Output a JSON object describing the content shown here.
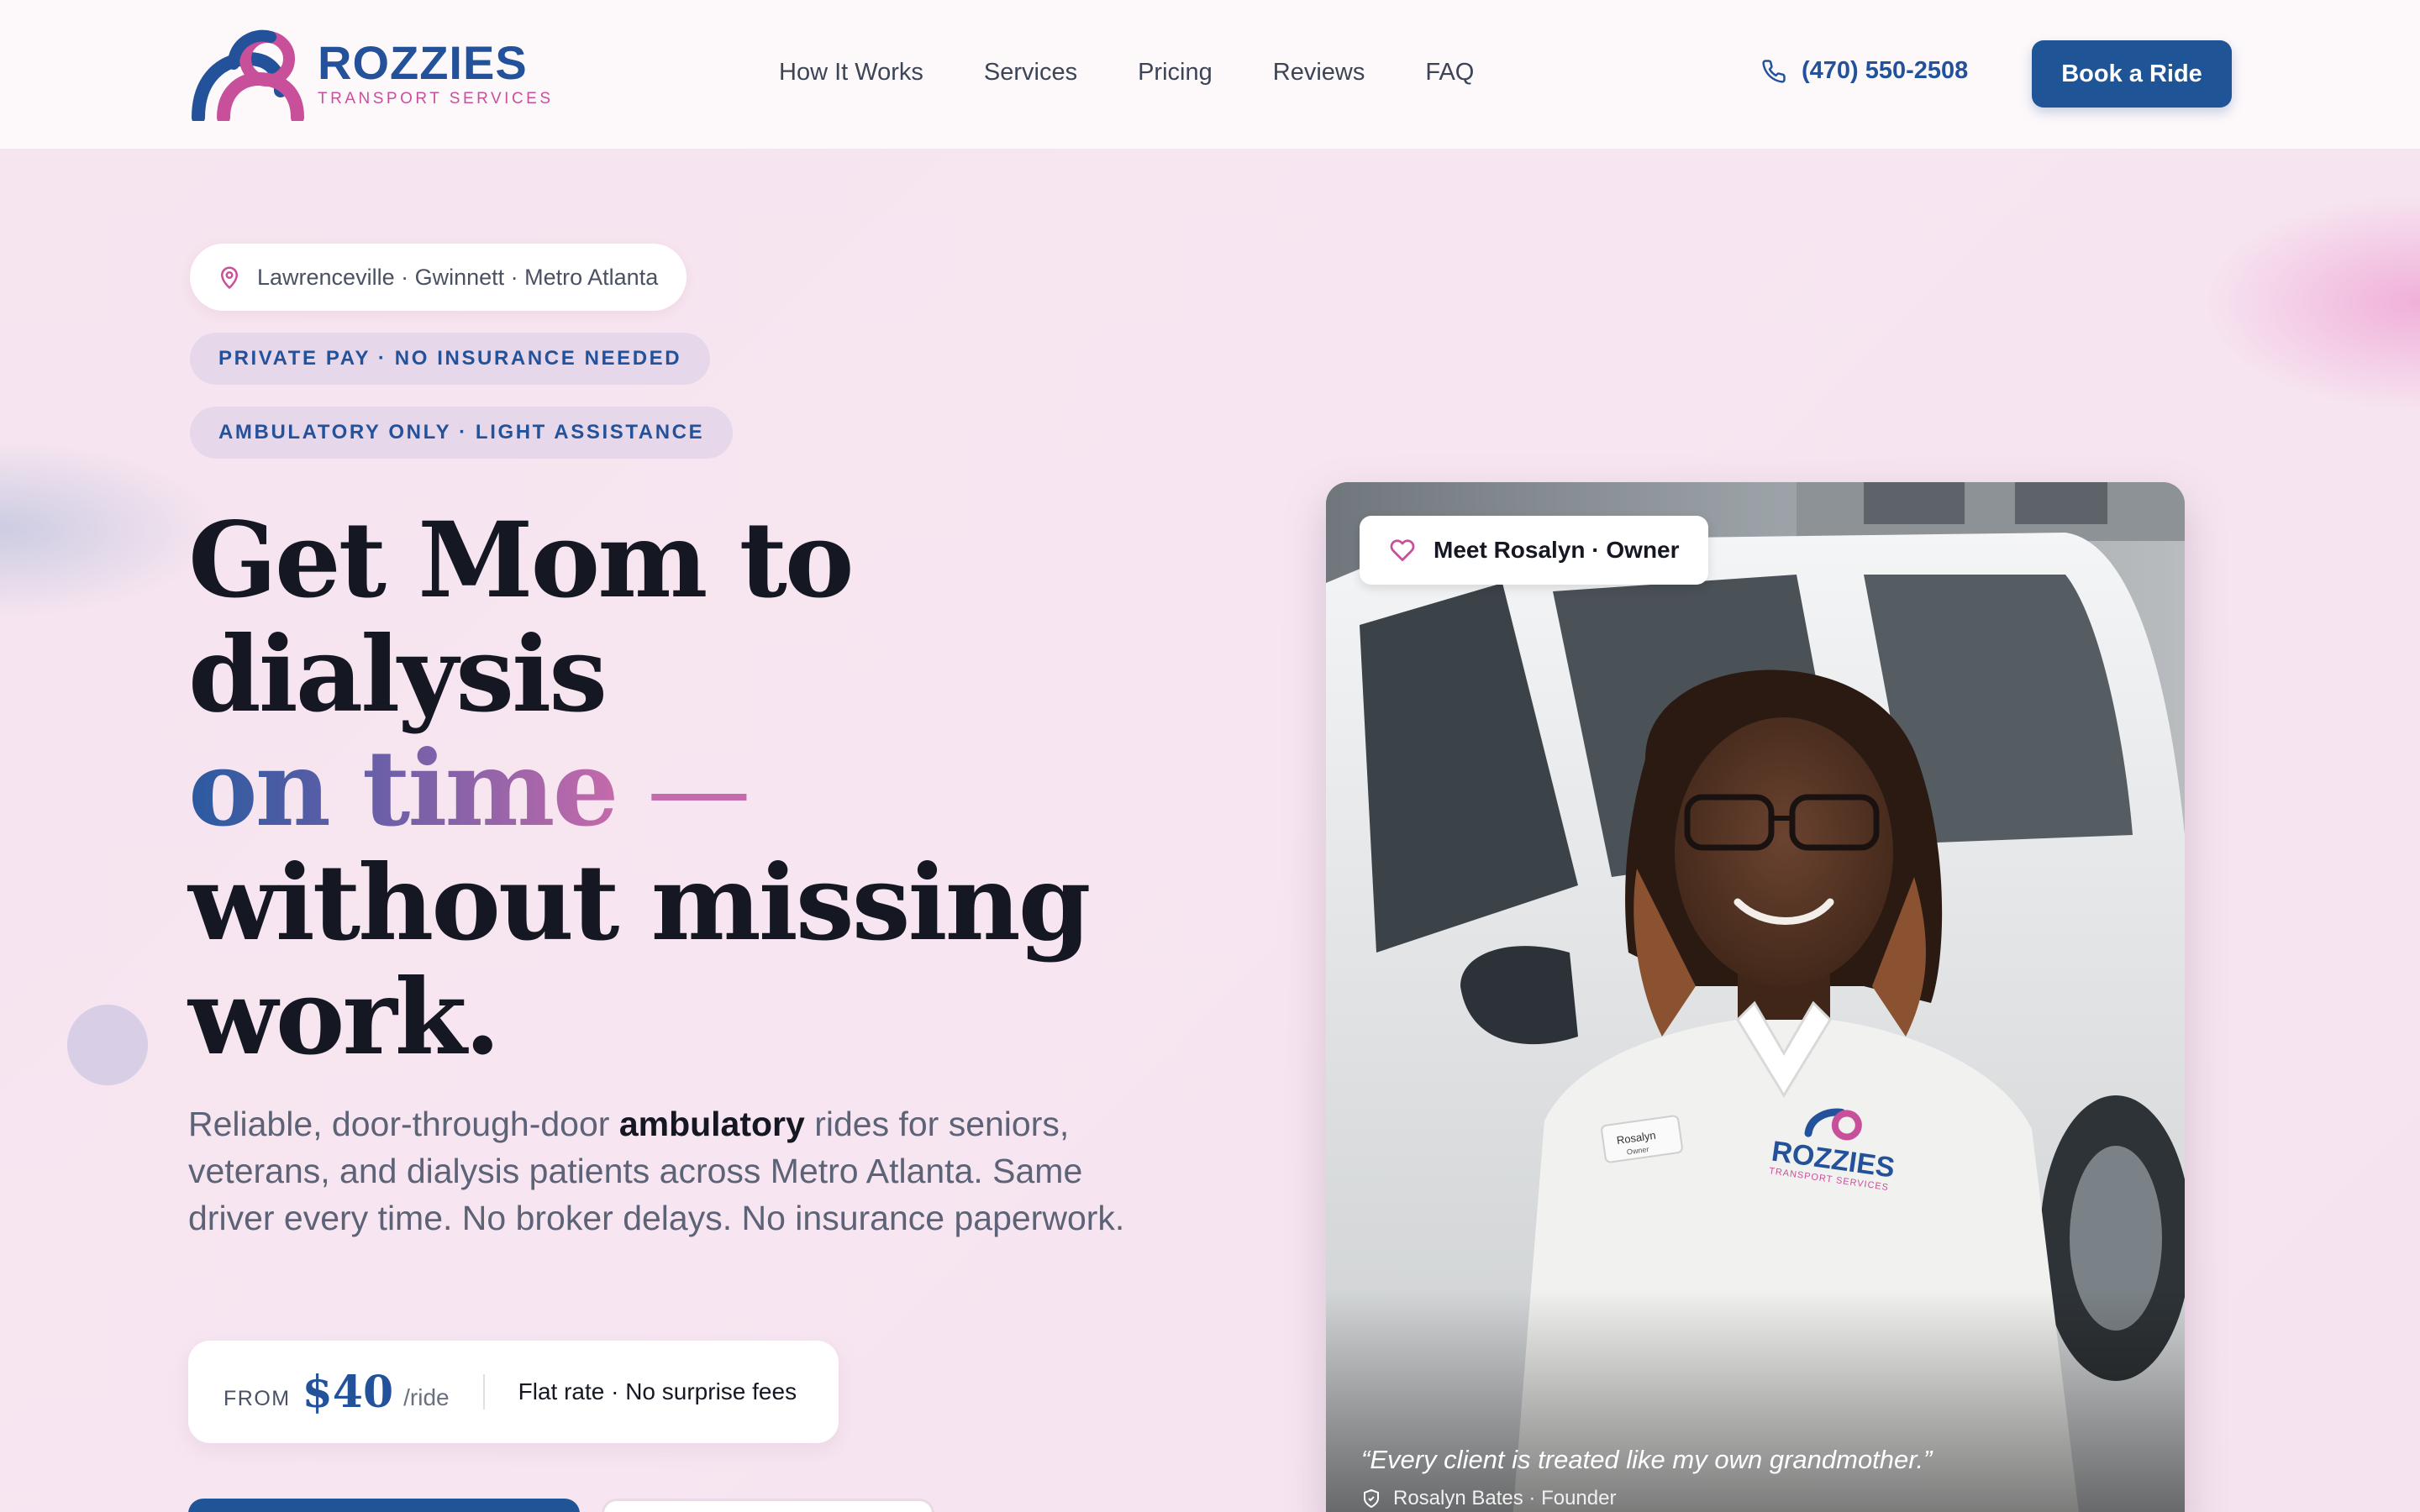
{
  "brand": {
    "name": "ROZZIES",
    "subtitle": "TRANSPORT SERVICES",
    "colors": {
      "blue": "#1f5497",
      "pink": "#c8509a"
    }
  },
  "nav": {
    "links": [
      "How It Works",
      "Services",
      "Pricing",
      "Reviews",
      "FAQ"
    ],
    "phone": "(470) 550-2508",
    "cta": "Book a Ride"
  },
  "hero": {
    "location": "Lawrenceville · Gwinnett · Metro Atlanta",
    "tags": [
      "PRIVATE PAY · NO INSURANCE NEEDED",
      "AMBULATORY ONLY · LIGHT ASSISTANCE"
    ],
    "headline": {
      "line1": "Get Mom to",
      "line2": "dialysis",
      "line3_highlight": "on time",
      "line3_dash": " —",
      "line4": "without missing",
      "line5": "work."
    },
    "lead": {
      "before": "Reliable, door-through-door ",
      "bold": "ambulatory",
      "after": " rides for seniors, veterans, and dialysis patients across Metro Atlanta. Same driver every time. No broker delays. No insurance paperwork."
    },
    "price": {
      "from_label": "FROM",
      "amount": "$40",
      "unit": "/ride",
      "note": "Flat rate · No surprise fees"
    }
  },
  "owner_card": {
    "badge": "Meet Rosalyn · Owner",
    "quote": "“Every client is treated like my own grandmother.”",
    "byline": "Rosalyn Bates · Founder",
    "shirt_logo": "ROZZIES",
    "shirt_sub": "TRANSPORT SERVICES",
    "name_tag": "Rosalyn",
    "name_tag_sub": "Owner"
  }
}
